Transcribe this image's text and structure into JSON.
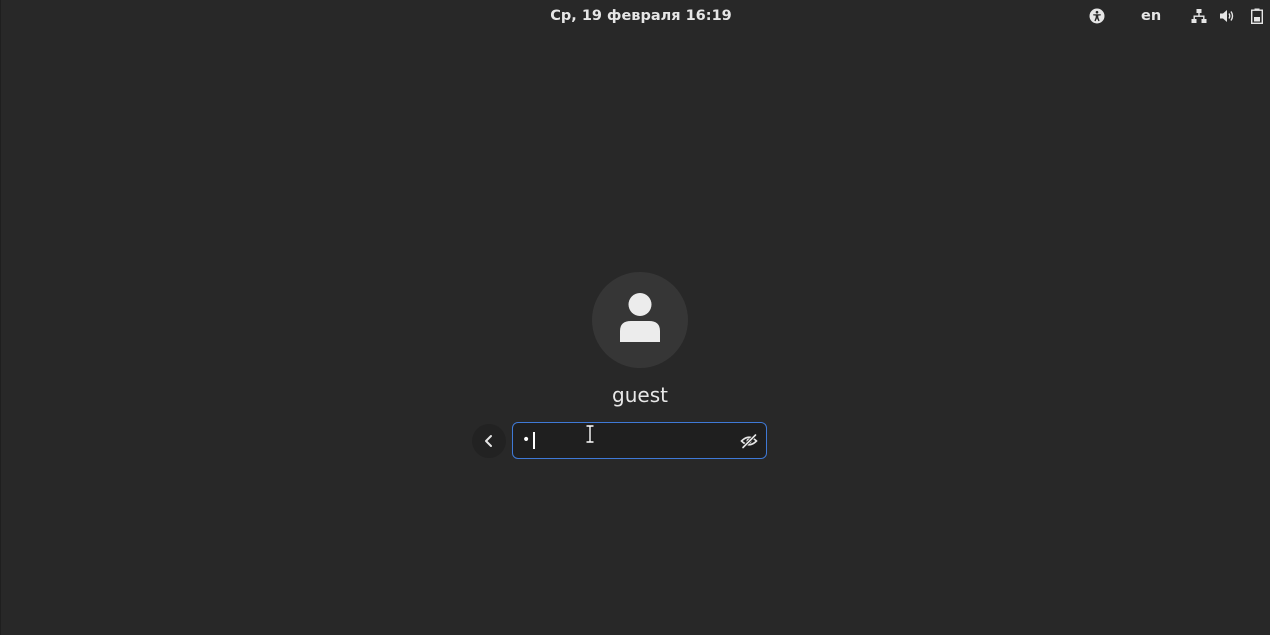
{
  "topbar": {
    "datetime": "Ср, 19 февраля  16:19",
    "language": "en",
    "icons": [
      "accessibility-icon",
      "network-icon",
      "volume-icon",
      "battery-icon"
    ]
  },
  "login": {
    "username": "guest",
    "password_value": "•",
    "back_icon": "chevron-left-icon",
    "reveal_icon": "eye-crossed-icon"
  },
  "colors": {
    "background": "#282828",
    "field_border": "#3f79d6",
    "avatar_bg": "#363636"
  }
}
